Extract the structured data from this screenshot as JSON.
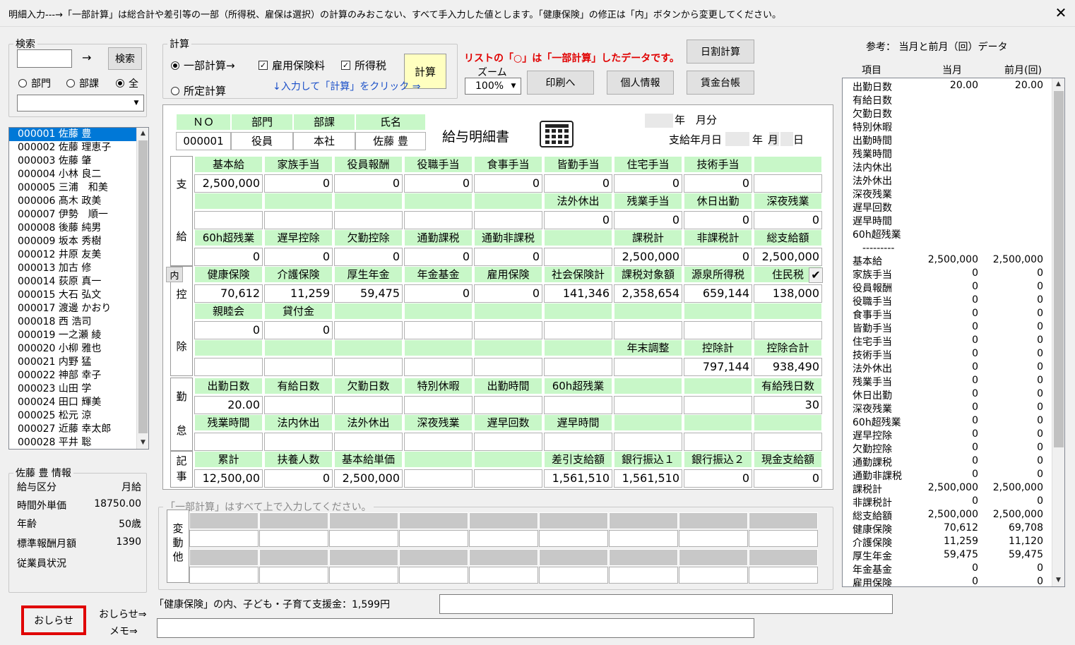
{
  "title": "明細入力---→「一部計算」は総合計や差引等の一部（所得税、雇保は選択）の計算のみおこない、すべて手入力した値とします。「健康保険」の修正は「内」ボタンから変更してください。",
  "close": "✕",
  "search": {
    "legend": "検索",
    "arrow": "→",
    "button": "検索",
    "radios": [
      "部門",
      "部課",
      "全"
    ],
    "selected": 2
  },
  "calc": {
    "legend": "計算",
    "radio1": "一部計算→",
    "radio2": "所定計算",
    "chk1": "雇用保険料",
    "chk2": "所得税",
    "chk_mark": "✓",
    "calc_btn": "計算",
    "hint": "↓入力して「計算」をクリック ⇒"
  },
  "notice_red": "リストの「○」は「一部計算」したデータです。",
  "zoom": {
    "label": "ズーム",
    "value": "100%"
  },
  "buttons": {
    "print": "印刷へ",
    "personal": "個人情報",
    "daily": "日割計算",
    "ledger": "賃金台帳",
    "oshirase": "おしらせ",
    "oshirase_link": "おしらせ⇒",
    "memo_link": "メモ⇒"
  },
  "employees": [
    "000001 佐藤 豊",
    "000002 佐藤 理恵子",
    "000003 佐藤 肇",
    "000004 小林 良二",
    "000005 三浦　和美",
    "000006 髙木 政美",
    "000007 伊勢　順一",
    "000008 後藤 純男",
    "000009 坂本 秀樹",
    "000012 井原 友美",
    "000013 加古 修",
    "000014 荻原 真一",
    "000015 大石 弘文",
    "000017 渡邊 かおり",
    "000018 西 浩司",
    "000019 一之瀬 綾",
    "000020 小柳 雅也",
    "000021 内野 猛",
    "000022 神部 幸子",
    "000023 山田 学",
    "000024 田口 輝美",
    "000025 松元 涼",
    "000027 近藤 幸太郎",
    "000028 平井 聡"
  ],
  "info": {
    "legend": "佐藤 豊 情報",
    "rows": [
      [
        "給与区分",
        "月給"
      ],
      [
        "時間外単価",
        "18750.00"
      ],
      [
        "年齢",
        "50歳"
      ],
      [
        "標準報酬月額",
        "1390"
      ],
      [
        "従業員状況",
        ""
      ]
    ]
  },
  "slip": {
    "head_labels": [
      "ＮＯ",
      "部門",
      "部課",
      "氏名"
    ],
    "head_values": [
      "000001",
      "役員",
      "本社",
      "佐藤 豊"
    ],
    "title": "給与明細書",
    "year_month": "年　月分",
    "pay_date": {
      "label": "支給年月日",
      "year": "年",
      "month": "月",
      "day": "日"
    },
    "side_shikyu": [
      "支",
      "給"
    ],
    "side_kojo": [
      "控",
      "除"
    ],
    "side_kintai": [
      "勤",
      "怠"
    ],
    "side_kiji": [
      "記",
      "事"
    ],
    "uchi": "内",
    "check": "✔",
    "rows": [
      {
        "h": [
          "基本給",
          "家族手当",
          "役員報酬",
          "役職手当",
          "食事手当",
          "皆勤手当",
          "住宅手当",
          "技術手当",
          ""
        ],
        "v": [
          "2,500,000",
          "0",
          "0",
          "0",
          "0",
          "0",
          "0",
          "0",
          ""
        ]
      },
      {
        "h": [
          "",
          "",
          "",
          "",
          "",
          "法外休出",
          "残業手当",
          "休日出勤",
          "深夜残業"
        ],
        "v": [
          "",
          "",
          "",
          "",
          "",
          "0",
          "0",
          "0",
          "0"
        ]
      },
      {
        "h": [
          "60h超残業",
          "遅早控除",
          "欠勤控除",
          "通勤課税",
          "通勤非課税",
          "",
          "課税計",
          "非課税計",
          "総支給額"
        ],
        "v": [
          "0",
          "0",
          "0",
          "0",
          "0",
          "",
          "2,500,000",
          "0",
          "2,500,000"
        ]
      },
      {
        "h": [
          "健康保険",
          "介護保険",
          "厚生年金",
          "年金基金",
          "雇用保険",
          "社会保険計",
          "課税対象額",
          "源泉所得税",
          "住民税"
        ],
        "v": [
          "70,612",
          "11,259",
          "59,475",
          "0",
          "0",
          "141,346",
          "2,358,654",
          "659,144",
          "138,000"
        ]
      },
      {
        "h": [
          "親睦会",
          "貸付金",
          "",
          "",
          "",
          "",
          "",
          "",
          ""
        ],
        "v": [
          "0",
          "0",
          "",
          "",
          "",
          "",
          "",
          "",
          ""
        ]
      },
      {
        "h": [
          "",
          "",
          "",
          "",
          "",
          "",
          "年末調整",
          "控除計",
          "控除合計"
        ],
        "v": [
          "",
          "",
          "",
          "",
          "",
          "",
          "",
          "797,144",
          "938,490"
        ]
      },
      {
        "h": [
          "出勤日数",
          "有給日数",
          "欠勤日数",
          "特別休暇",
          "出勤時間",
          "60h超残業",
          "",
          "",
          "有給残日数"
        ],
        "v": [
          "20.00",
          "",
          "",
          "",
          "",
          "",
          "",
          "",
          "30"
        ]
      },
      {
        "h": [
          "残業時間",
          "法内休出",
          "法外休出",
          "深夜残業",
          "遅早回数",
          "遅早時間",
          "",
          "",
          ""
        ],
        "v": [
          "",
          "",
          "",
          "",
          "",
          "",
          "",
          "",
          ""
        ]
      },
      {
        "h": [
          "累計",
          "扶養人数",
          "基本給単価",
          "",
          "",
          "差引支給額",
          "銀行振込１",
          "銀行振込２",
          "現金支給額"
        ],
        "v": [
          "12,500,00",
          "0",
          "2,500,000",
          "",
          "",
          "1,561,510",
          "1,561,510",
          "0",
          "0"
        ]
      }
    ]
  },
  "hendo": {
    "legend": "「一部計算」はすべて上で入力してください。",
    "side": [
      "変",
      "動",
      "他"
    ]
  },
  "kenpo_note": "「健康保険」の内、子ども・子育て支援金：1,599円",
  "ref": {
    "title": "参考：  当月と前月（回）データ",
    "headers": [
      "項目",
      "当月",
      "前月(回)"
    ],
    "rows": [
      [
        "出勤日数",
        "20.00",
        "20.00"
      ],
      [
        "有給日数",
        "",
        ""
      ],
      [
        "欠勤日数",
        "",
        ""
      ],
      [
        "特別休暇",
        "",
        ""
      ],
      [
        "出勤時間",
        "",
        ""
      ],
      [
        "残業時間",
        "",
        ""
      ],
      [
        "法内休出",
        "",
        ""
      ],
      [
        "法外休出",
        "",
        ""
      ],
      [
        "深夜残業",
        "",
        ""
      ],
      [
        "遅早回数",
        "",
        ""
      ],
      [
        "遅早時間",
        "",
        ""
      ],
      [
        "60h超残業",
        "",
        ""
      ],
      [
        "　---------",
        "",
        ""
      ],
      [
        "基本給",
        "2,500,000",
        "2,500,000"
      ],
      [
        "家族手当",
        "0",
        "0"
      ],
      [
        "役員報酬",
        "0",
        "0"
      ],
      [
        "役職手当",
        "0",
        "0"
      ],
      [
        "食事手当",
        "0",
        "0"
      ],
      [
        "皆勤手当",
        "0",
        "0"
      ],
      [
        "住宅手当",
        "0",
        "0"
      ],
      [
        "技術手当",
        "0",
        "0"
      ],
      [
        "法外休出",
        "0",
        "0"
      ],
      [
        "残業手当",
        "0",
        "0"
      ],
      [
        "休日出勤",
        "0",
        "0"
      ],
      [
        "深夜残業",
        "0",
        "0"
      ],
      [
        "60h超残業",
        "0",
        "0"
      ],
      [
        "遅早控除",
        "0",
        "0"
      ],
      [
        "欠勤控除",
        "0",
        "0"
      ],
      [
        "通勤課税",
        "0",
        "0"
      ],
      [
        "通勤非課税",
        "0",
        "0"
      ],
      [
        "課税計",
        "2,500,000",
        "2,500,000"
      ],
      [
        "非課税計",
        "0",
        "0"
      ],
      [
        "総支給額",
        "2,500,000",
        "2,500,000"
      ],
      [
        "健康保険",
        "70,612",
        "69,708"
      ],
      [
        "介護保険",
        "11,259",
        "11,120"
      ],
      [
        "厚生年金",
        "59,475",
        "59,475"
      ],
      [
        "年金基金",
        "0",
        "0"
      ],
      [
        "雇用保険",
        "0",
        "0"
      ]
    ]
  },
  "colors": {
    "header_green": "#c8f7c8",
    "selection": "#0078d7",
    "red": "#e00000",
    "yellow_btn": "#ffffc0"
  }
}
